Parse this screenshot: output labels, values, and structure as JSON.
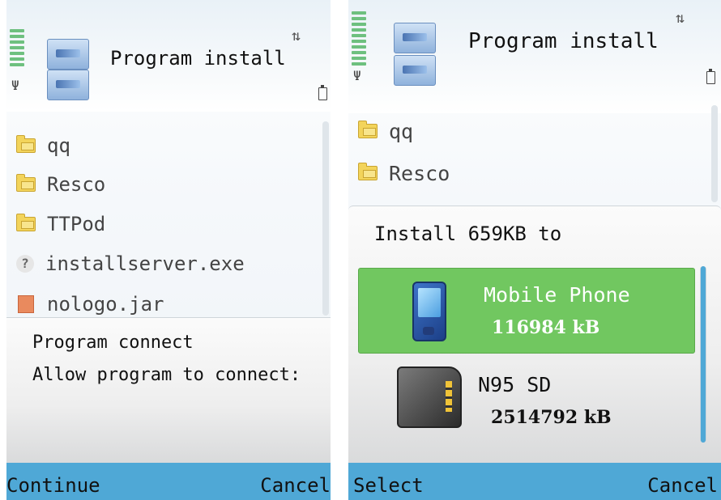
{
  "left_screen": {
    "title": "Program install",
    "files": [
      {
        "icon": "folder-icon",
        "name": "qq"
      },
      {
        "icon": "folder-icon",
        "name": "Resco"
      },
      {
        "icon": "folder-icon",
        "name": "TTPod"
      },
      {
        "icon": "unknown-file-icon",
        "name": "installserver.exe"
      },
      {
        "icon": "jar-file-icon",
        "name": "nologo.jar"
      }
    ],
    "dialog": {
      "line1": "Program connect",
      "line2": "Allow program to connect:"
    },
    "softkeys": {
      "left": "Continue",
      "right": "Cancel"
    }
  },
  "right_screen": {
    "title": "Program install",
    "files": [
      {
        "icon": "folder-icon",
        "name": "qq"
      },
      {
        "icon": "folder-icon",
        "name": "Resco"
      }
    ],
    "dialog": {
      "heading": "Install 659KB to",
      "options": [
        {
          "icon": "mobile-phone-icon",
          "name": "Mobile Phone",
          "size": "116984 kB",
          "selected": true
        },
        {
          "icon": "sd-card-icon",
          "name": "N95 SD",
          "size": "2514792 kB",
          "selected": false
        }
      ]
    },
    "softkeys": {
      "left": "Select",
      "right": "Cancel"
    }
  },
  "colors": {
    "softkey_bar": "#4fa8d6",
    "selected_option": "#71c760",
    "signal": "#6ec07f"
  }
}
